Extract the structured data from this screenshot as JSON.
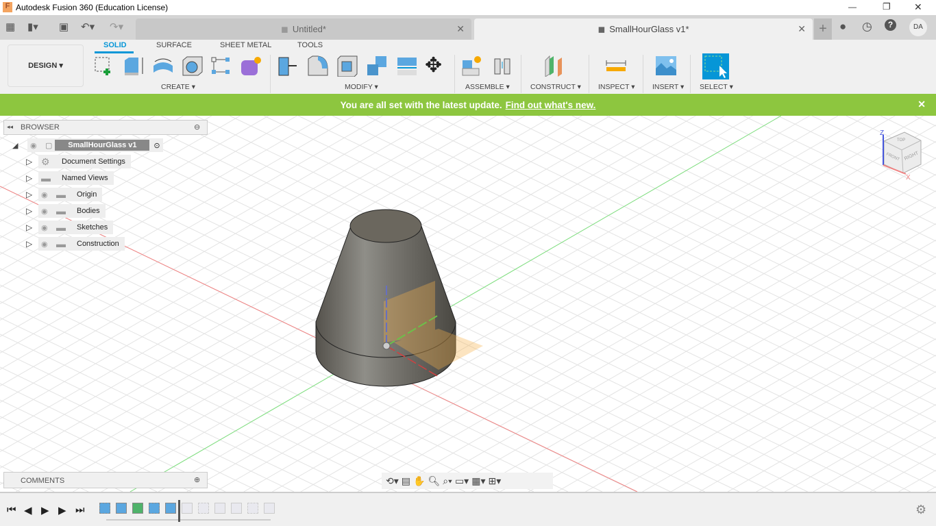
{
  "window": {
    "title": "Autodesk Fusion 360 (Education License)",
    "app_icon": "F"
  },
  "window_controls": {
    "minimize": "—",
    "restore": "❐",
    "close": "✕"
  },
  "tabs": [
    {
      "label": "Untitled*",
      "active": false
    },
    {
      "label": "SmallHourGlass v1*",
      "active": true
    }
  ],
  "tab_close": "✕",
  "user": {
    "initials": "DA"
  },
  "workspace": {
    "label": "DESIGN ▾"
  },
  "toolbar_tabs": [
    "SOLID",
    "SURFACE",
    "SHEET METAL",
    "TOOLS"
  ],
  "groups": [
    "CREATE ▾",
    "MODIFY ▾",
    "ASSEMBLE ▾",
    "CONSTRUCT ▾",
    "INSPECT ▾",
    "INSERT ▾",
    "SELECT ▾"
  ],
  "banner": {
    "text": "You are all set with the latest update.",
    "link": "Find out what's new.",
    "close": "✕",
    "color": "#8dc63f"
  },
  "browser": {
    "title": "BROWSER",
    "root": "SmallHourGlass v1",
    "items": [
      "Document Settings",
      "Named Views",
      "Origin",
      "Bodies",
      "Sketches",
      "Construction"
    ]
  },
  "comments": {
    "title": "COMMENTS"
  },
  "viewcube": {
    "top": "TOP",
    "front": "FRONT",
    "right": "RIGHT",
    "z": "Z",
    "x": "X"
  },
  "accent": "#0696d7"
}
